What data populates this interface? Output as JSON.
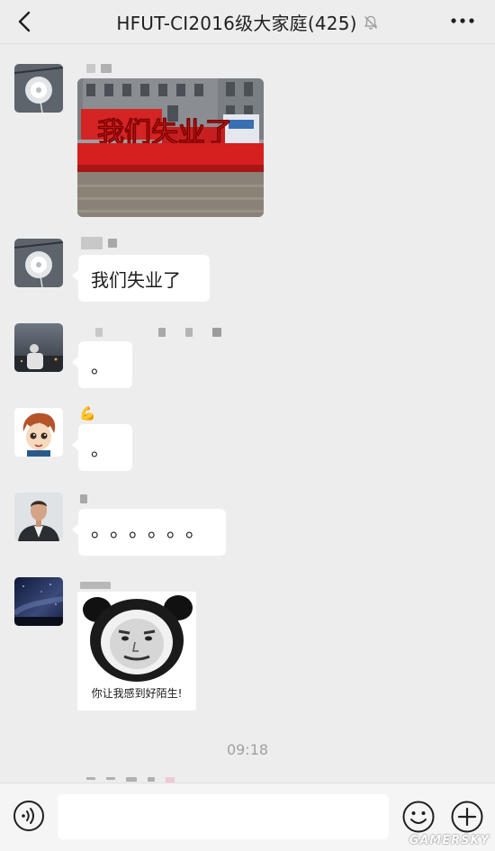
{
  "header": {
    "title": "HFUT-CI2016级大家庭(425)",
    "back_icon": "chevron-left-icon",
    "mute_icon": "bell-mute-icon",
    "more_icon": "more-dots-icon"
  },
  "messages": [
    {
      "type": "image",
      "sender": "dandelion-avatar",
      "image_text": "我们失业了"
    },
    {
      "type": "text",
      "sender": "dandelion-avatar",
      "text": "我们失业了"
    },
    {
      "type": "text",
      "sender": "night-photo-avatar",
      "text": "。"
    },
    {
      "type": "text",
      "sender": "cartoon-avatar",
      "nickname_emoji": "💪",
      "text": "。"
    },
    {
      "type": "text",
      "sender": "man-suit-avatar",
      "text": "。。。。。。"
    },
    {
      "type": "sticker",
      "sender": "starry-sky-avatar",
      "caption": "你让我感到好陌生!"
    }
  ],
  "timestamp": "09:18",
  "input_bar": {
    "voice_icon": "voice-icon",
    "emoji_icon": "emoji-icon",
    "plus_icon": "plus-icon",
    "placeholder": ""
  },
  "watermark": "GAMERSKY",
  "colors": {
    "background": "#ededed",
    "bubble": "#ffffff",
    "banner_red": "#d42424"
  }
}
